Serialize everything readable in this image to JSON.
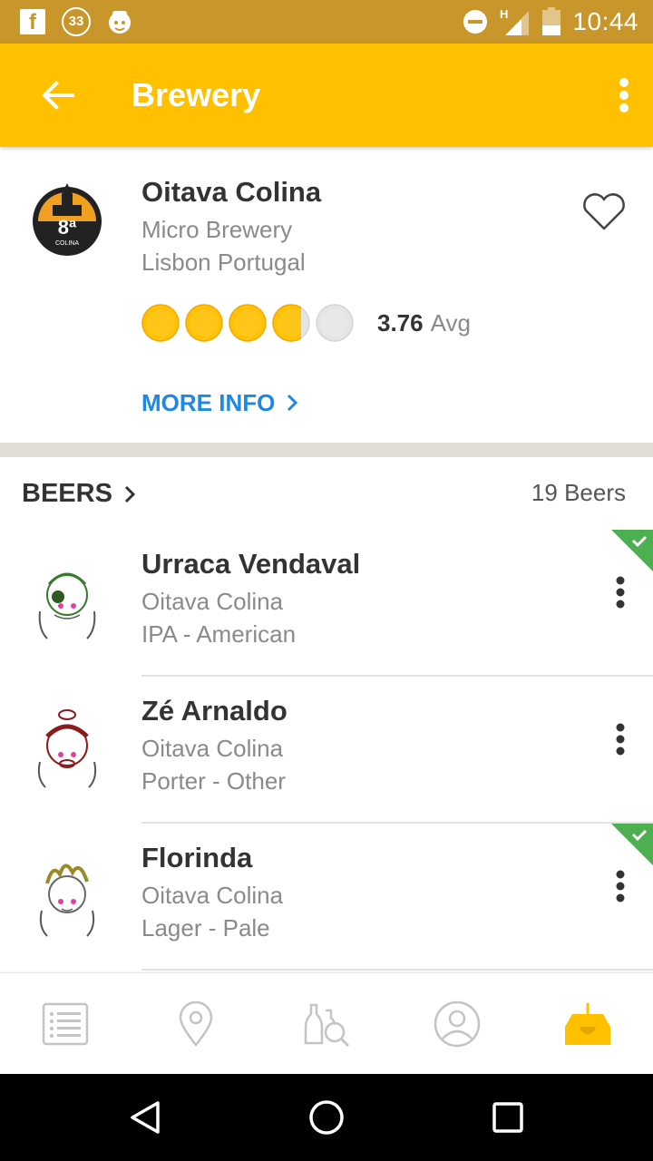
{
  "status_bar": {
    "notification_count": "33",
    "time": "10:44",
    "network": "H"
  },
  "app_bar": {
    "title": "Brewery"
  },
  "brewery": {
    "name": "Oitava Colina",
    "type": "Micro Brewery",
    "location": "Lisbon Portugal",
    "rating_value": "3.76",
    "rating_suffix": "Avg",
    "rating": 3.76,
    "rating_max": 5,
    "more_info_label": "MORE INFO",
    "logo_text": "8ª",
    "logo_subtext": "COLINA"
  },
  "beers": {
    "title": "BEERS",
    "count": "19 Beers",
    "items": [
      {
        "name": "Urraca Vendaval",
        "brewery": "Oitava Colina",
        "style": "IPA - American",
        "had": true
      },
      {
        "name": "Zé Arnaldo",
        "brewery": "Oitava Colina",
        "style": "Porter - Other",
        "had": false
      },
      {
        "name": "Florinda",
        "brewery": "Oitava Colina",
        "style": "Lager - Pale",
        "had": true
      }
    ]
  },
  "colors": {
    "accent": "#ffc000",
    "status_bar": "#c8962a",
    "link": "#1e88e5",
    "badge_green": "#4caf50",
    "cap_gold": "#ffc107"
  },
  "bottom_nav": {
    "items": [
      "list-icon",
      "map-pin-icon",
      "beer-search-icon",
      "profile-icon",
      "inbox-icon"
    ],
    "active": "inbox-icon"
  }
}
